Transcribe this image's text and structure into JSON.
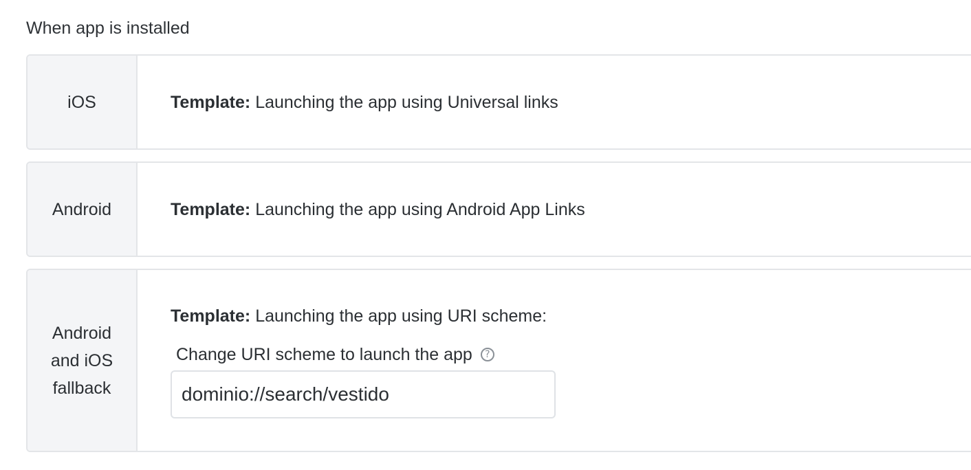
{
  "section": {
    "title": "When app is installed"
  },
  "cards": {
    "ios": {
      "platform": "iOS",
      "template_label": "Template:",
      "template_text": "Launching the app using Universal links"
    },
    "android": {
      "platform": "Android",
      "template_label": "Template:",
      "template_text": "Launching the app using Android App Links"
    },
    "fallback": {
      "platform": "Android and iOS fallback",
      "template_label": "Template:",
      "template_text": "Launching the app using URI scheme:",
      "uri_label": "Change URI scheme to launch the app",
      "help_icon": "?",
      "uri_value": "dominio://search/vestido"
    }
  }
}
